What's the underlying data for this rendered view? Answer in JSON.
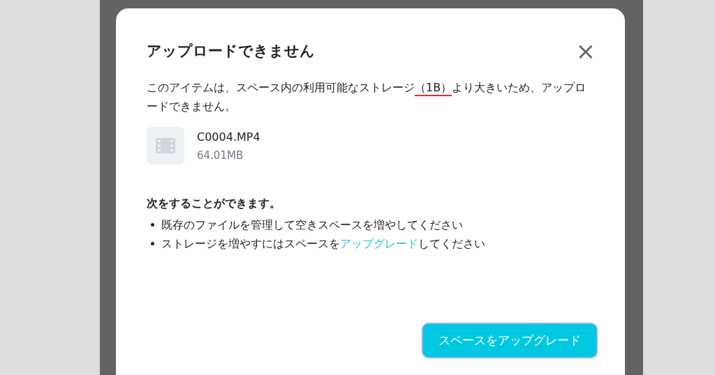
{
  "dialog": {
    "title": "アップロードできません",
    "close_label": "×",
    "message": {
      "before": "このアイテムは、スペース内の利用可能なストレージ",
      "highlight": "（1B）",
      "after": "より大きいため、アップロードできません。"
    },
    "file": {
      "name": "C0004.MP4",
      "size": "64.01MB"
    },
    "options_heading": "次をすることができます。",
    "options": [
      {
        "before": "既存のファイルを管理して空きスペースを増やしてください"
      },
      {
        "before": "ストレージを増やすにはスペースを",
        "link": "アップグレード",
        "after": "してください"
      }
    ],
    "button": "スペースをアップグレード"
  }
}
